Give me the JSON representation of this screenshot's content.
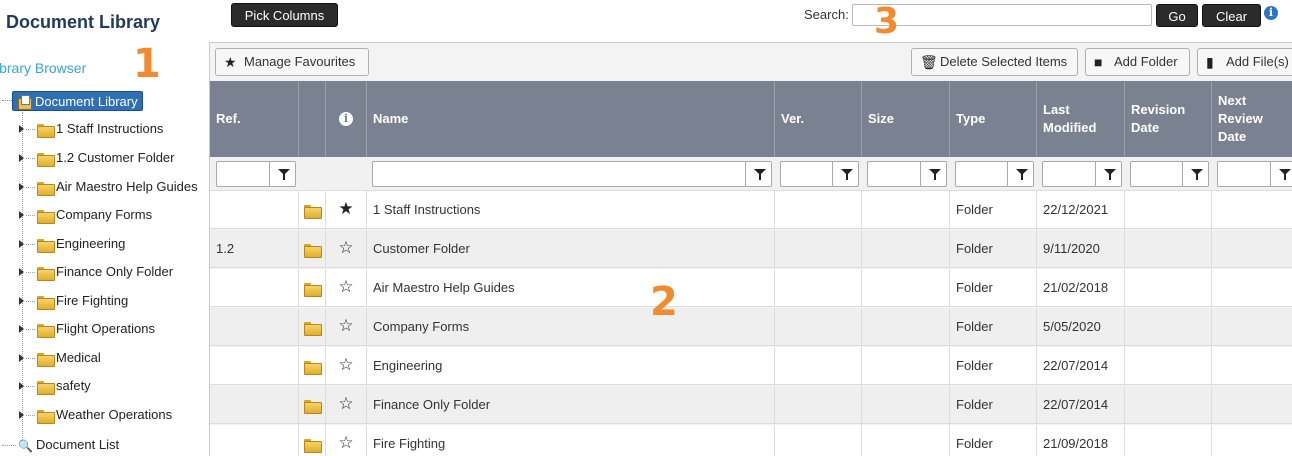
{
  "sidebar": {
    "title": "Document Library",
    "library_browser": "ibrary Browser",
    "root": "Document Library",
    "items": [
      "1 Staff Instructions",
      "1.2 Customer Folder",
      "Air Maestro Help Guides",
      "Company Forms",
      "Engineering",
      "Finance Only Folder",
      "Fire Fighting",
      "Flight Operations",
      "Medical",
      "safety",
      "Weather Operations"
    ],
    "doc_list": "Document List"
  },
  "annotations": {
    "one": "1",
    "two": "2",
    "three": "3"
  },
  "topbar": {
    "pick_columns": "Pick Columns",
    "search_label": "Search:",
    "search_value": "",
    "go": "Go",
    "clear": "Clear",
    "info": "i"
  },
  "toolbar": {
    "manage_favourites": "Manage Favourites",
    "delete_selected": "Delete Selected Items",
    "add_folder": "Add Folder",
    "add_files": "Add File(s)"
  },
  "table": {
    "headers": [
      "Ref.",
      "",
      "i",
      "Name",
      "Ver.",
      "Size",
      "Type",
      "Last Modified",
      "Revision Date",
      "Next Review Date"
    ],
    "rows": [
      {
        "ref": "",
        "fav": "★",
        "name": "1 Staff Instructions",
        "ver": "",
        "size": "",
        "type": "Folder",
        "modified": "22/12/2021",
        "revision": "",
        "review": ""
      },
      {
        "ref": "1.2",
        "fav": "☆",
        "name": "Customer Folder",
        "ver": "",
        "size": "",
        "type": "Folder",
        "modified": "9/11/2020",
        "revision": "",
        "review": ""
      },
      {
        "ref": "",
        "fav": "☆",
        "name": "Air Maestro Help Guides",
        "ver": "",
        "size": "",
        "type": "Folder",
        "modified": "21/02/2018",
        "revision": "",
        "review": ""
      },
      {
        "ref": "",
        "fav": "☆",
        "name": "Company Forms",
        "ver": "",
        "size": "",
        "type": "Folder",
        "modified": "5/05/2020",
        "revision": "",
        "review": ""
      },
      {
        "ref": "",
        "fav": "☆",
        "name": "Engineering",
        "ver": "",
        "size": "",
        "type": "Folder",
        "modified": "22/07/2014",
        "revision": "",
        "review": ""
      },
      {
        "ref": "",
        "fav": "☆",
        "name": "Finance Only Folder",
        "ver": "",
        "size": "",
        "type": "Folder",
        "modified": "22/07/2014",
        "revision": "",
        "review": ""
      },
      {
        "ref": "",
        "fav": "☆",
        "name": "Fire Fighting",
        "ver": "",
        "size": "",
        "type": "Folder",
        "modified": "21/09/2018",
        "revision": "",
        "review": ""
      }
    ]
  },
  "colors": {
    "header_bg": "#7a8291",
    "accent": "#2f6fb5",
    "annotation": "#f28a30",
    "link": "#3aa3d9"
  }
}
